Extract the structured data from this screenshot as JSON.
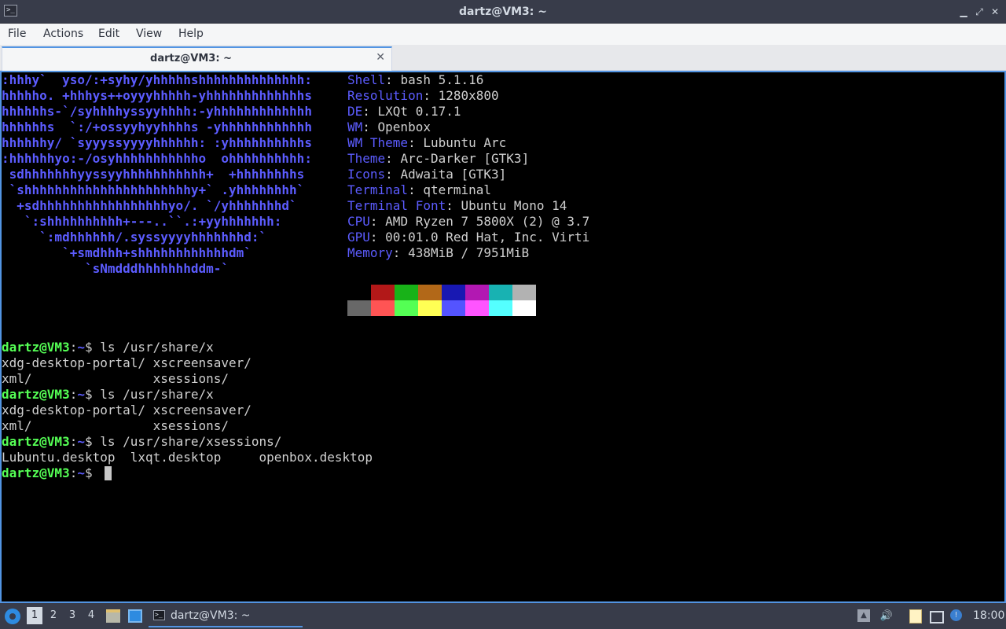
{
  "window": {
    "title": "dartz@VM3: ~",
    "controls": {
      "minimize": "minimize-icon",
      "maximize": "maximize-icon",
      "close": "close-icon"
    }
  },
  "menubar": {
    "items": [
      "File",
      "Actions",
      "Edit",
      "View",
      "Help"
    ]
  },
  "tabs": [
    {
      "label": "dartz@VM3: ~",
      "close_icon": "close-icon"
    }
  ],
  "terminal": {
    "logo_lines": [
      ":hhhy`  yso/:+syhy/yhhhhhshhhhhhhhhhhhhh:",
      "hhhhho. +hhhys++oyyyhhhhh-yhhhhhhhhhhhhhs",
      "hhhhhhs-`/syhhhhyssyyhhhh:-yhhhhhhhhhhhhh",
      "hhhhhhs  `:/+ossyyhyyhhhhs -yhhhhhhhhhhhh",
      "hhhhhhy/ `syyyssyyyyhhhhhh: :yhhhhhhhhhhs",
      ":hhhhhhyo:-/osyhhhhhhhhhhho  ohhhhhhhhhh:",
      " sdhhhhhhhyyssyyhhhhhhhhhhh+  +hhhhhhhhs",
      " `shhhhhhhhhhhhhhhhhhhhhhy+` .yhhhhhhhh`",
      "  +sdhhhhhhhhhhhhhhhhhyo/. `/yhhhhhhhd`",
      "   `:shhhhhhhhhh+---..``.:+yyhhhhhhh:",
      "     `:mdhhhhhh/.syssyyyyhhhhhhhd:`",
      "        `+smdhhh+shhhhhhhhhhhhdm`",
      "           `sNmdddhhhhhhhddm-`"
    ],
    "info": [
      {
        "key": "Shell",
        "value": "bash 5.1.16"
      },
      {
        "key": "Resolution",
        "value": "1280x800"
      },
      {
        "key": "DE",
        "value": "LXQt 0.17.1"
      },
      {
        "key": "WM",
        "value": "Openbox"
      },
      {
        "key": "WM Theme",
        "value": "Lubuntu Arc"
      },
      {
        "key": "Theme",
        "value": "Arc-Darker [GTK3]"
      },
      {
        "key": "Icons",
        "value": "Adwaita [GTK3]"
      },
      {
        "key": "Terminal",
        "value": "qterminal"
      },
      {
        "key": "Terminal Font",
        "value": "Ubuntu Mono 14"
      },
      {
        "key": "CPU",
        "value": "AMD Ryzen 7 5800X (2) @ 3.7"
      },
      {
        "key": "GPU",
        "value": "00:01.0 Red Hat, Inc. Virti"
      },
      {
        "key": "Memory",
        "value": "438MiB / 7951MiB"
      }
    ],
    "key_sep": ": ",
    "palette_dark": [
      "#000000",
      "#b21818",
      "#18b218",
      "#b26818",
      "#1818b2",
      "#b218b2",
      "#18b2b2",
      "#b2b2b2"
    ],
    "palette_bright": [
      "#686868",
      "#ff5454",
      "#54ff54",
      "#ffff54",
      "#5454ff",
      "#ff54ff",
      "#54ffff",
      "#ffffff"
    ],
    "prompt": {
      "user_host": "dartz@VM3",
      "colon": ":",
      "path": "~",
      "symbol": "$ "
    },
    "session": [
      {
        "command": "ls /usr/share/x",
        "output": [
          "xdg-desktop-portal/ xscreensaver/",
          "xml/                xsessions/"
        ]
      },
      {
        "command": "ls /usr/share/x",
        "output": [
          "xdg-desktop-portal/ xscreensaver/",
          "xml/                xsessions/"
        ]
      },
      {
        "command": "ls /usr/share/xsessions/",
        "output": [
          "Lubuntu.desktop  lxqt.desktop     openbox.desktop"
        ]
      },
      {
        "command": "",
        "output": []
      }
    ]
  },
  "taskbar": {
    "main_menu_icon": "lubuntu-menu-icon",
    "desktops": [
      "1",
      "2",
      "3",
      "4"
    ],
    "active_desktop": "1",
    "quicklaunch": [
      "file-manager-icon",
      "show-desktop-icon"
    ],
    "task": {
      "icon": "terminal-icon",
      "label": "dartz@VM3: ~"
    },
    "tray": [
      "tray-arrow-icon",
      "volume-icon",
      "clipboard-icon",
      "network-icon",
      "update-notifier-icon"
    ],
    "clock": "18:00"
  }
}
